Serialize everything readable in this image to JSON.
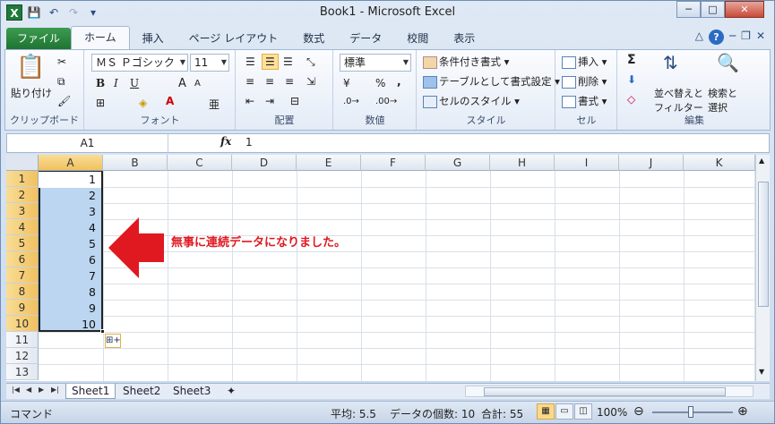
{
  "window": {
    "title": "Book1 - Microsoft Excel",
    "minimize": "─",
    "maximize": "□",
    "close": "✕"
  },
  "qat": {
    "app_icon": "X",
    "save": "💾",
    "undo": "↶",
    "redo": "↷",
    "customize": "▾"
  },
  "ribbon_tabs": [
    "ファイル",
    "ホーム",
    "挿入",
    "ページ レイアウト",
    "数式",
    "データ",
    "校閲",
    "表示"
  ],
  "help": {
    "help_icon": "?"
  },
  "clipboard": {
    "label": "クリップボード",
    "paste": "貼り付け"
  },
  "font": {
    "label": "フォント",
    "name": "ＭＳ Ｐゴシック",
    "size": "11",
    "bold": "B",
    "italic": "I",
    "underline": "U",
    "grow": "A",
    "shrink": "A",
    "font_color": "A",
    "phonetic": "亜"
  },
  "alignment": {
    "label": "配置"
  },
  "number": {
    "label": "数値",
    "format": "標準",
    "percent": "%",
    "comma": ","
  },
  "styles": {
    "label": "スタイル",
    "conditional": "条件付き書式",
    "table": "テーブルとして書式設定",
    "cell_styles": "セルのスタイル"
  },
  "cells": {
    "label": "セル",
    "insert": "挿入",
    "delete": "削除",
    "format": "書式"
  },
  "editing": {
    "label": "編集",
    "sum": "Σ",
    "sort_filter_1": "並べ替えと",
    "sort_filter_2": "フィルター",
    "find_select_1": "検索と",
    "find_select_2": "選択"
  },
  "formula_bar": {
    "name_box": "A1",
    "fx": "fx",
    "value": "1"
  },
  "columns": [
    "A",
    "B",
    "C",
    "D",
    "E",
    "F",
    "G",
    "H",
    "I",
    "J",
    "K"
  ],
  "rows": [
    "1",
    "2",
    "3",
    "4",
    "5",
    "6",
    "7",
    "8",
    "9",
    "10",
    "11",
    "12",
    "13"
  ],
  "cells_a": [
    "1",
    "2",
    "3",
    "4",
    "5",
    "6",
    "7",
    "8",
    "9",
    "10"
  ],
  "annotation": "無事に連続データになりました。",
  "sheet_tabs": [
    "Sheet1",
    "Sheet2",
    "Sheet3"
  ],
  "status": {
    "mode": "コマンド",
    "average": "平均: 5.5",
    "count": "データの個数: 10",
    "sum": "合計: 55",
    "zoom": "100%"
  },
  "colors": {
    "selection": "#bcd6f1",
    "header_selected": "#f1c15f",
    "annotation": "#e01820",
    "file_tab": "#1f7433"
  }
}
